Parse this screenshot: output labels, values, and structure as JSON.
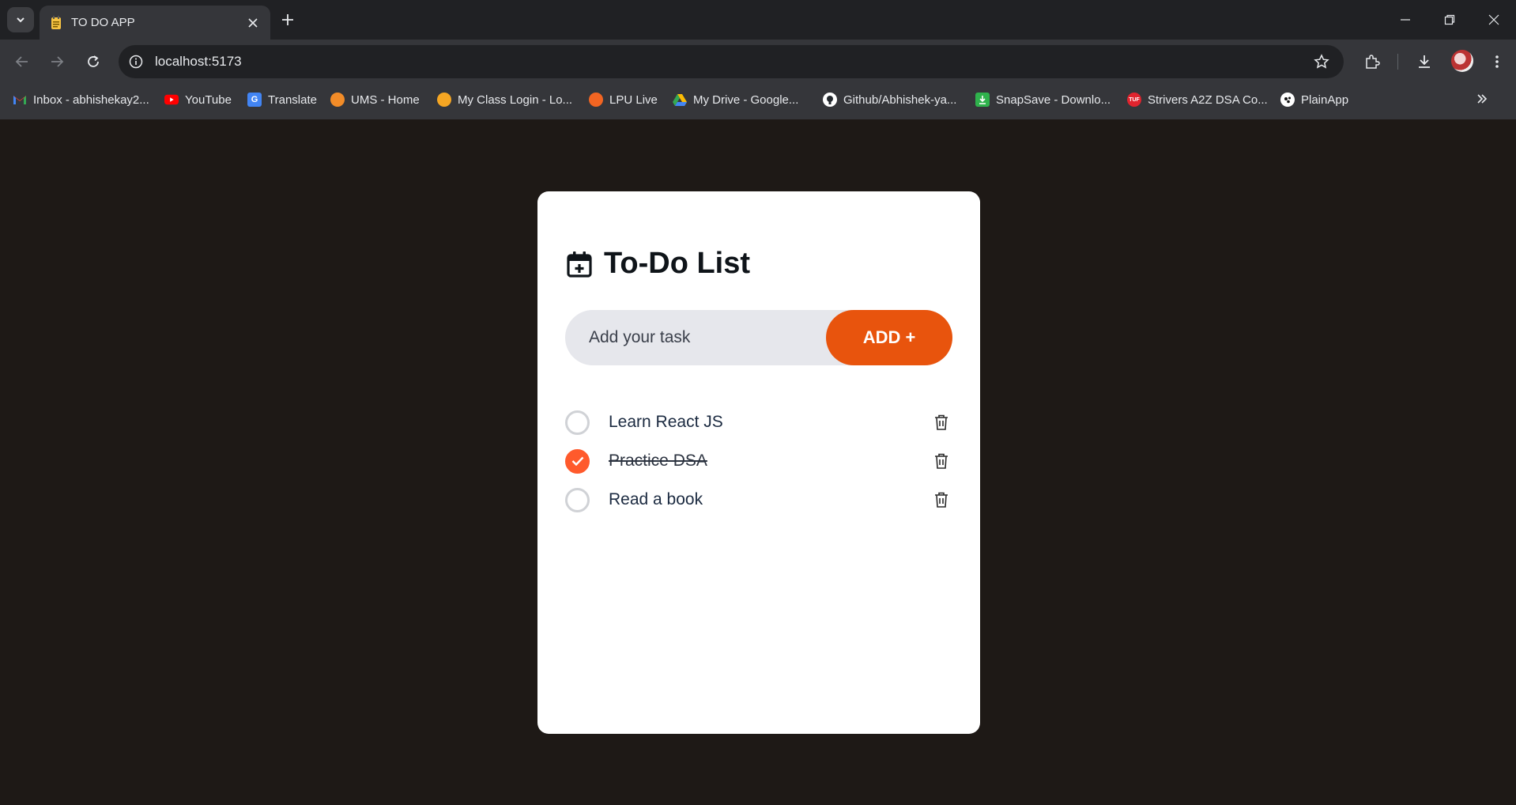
{
  "browser": {
    "tab_title": "TO DO APP",
    "url": "localhost:5173",
    "bookmarks": [
      {
        "label": "Inbox - abhishekay2...",
        "icon": "gmail-icon"
      },
      {
        "label": "YouTube",
        "icon": "youtube-icon"
      },
      {
        "label": "Translate",
        "icon": "translate-icon"
      },
      {
        "label": "UMS - Home",
        "icon": "ums-icon"
      },
      {
        "label": "My Class Login - Lo...",
        "icon": "myclass-icon"
      },
      {
        "label": "LPU Live",
        "icon": "lpu-live-icon"
      },
      {
        "label": "My Drive - Google...",
        "icon": "google-drive-icon"
      },
      {
        "label": "Github/Abhishek-ya...",
        "icon": "github-icon"
      },
      {
        "label": "SnapSave - Downlo...",
        "icon": "snapsave-icon"
      },
      {
        "label": "Strivers A2Z DSA Co...",
        "icon": "tuf-icon"
      },
      {
        "label": "PlainApp",
        "icon": "plainapp-icon"
      }
    ]
  },
  "app": {
    "title": "To-Do List",
    "input_placeholder": "Add your task",
    "add_button": "ADD +",
    "tasks": [
      {
        "text": "Learn React JS",
        "done": false
      },
      {
        "text": "Practice DSA",
        "done": true
      },
      {
        "text": "Read a book",
        "done": false
      }
    ]
  },
  "colors": {
    "accent": "#e8540d",
    "check_done": "#ff5a2c",
    "page_bg": "#1e1916"
  }
}
